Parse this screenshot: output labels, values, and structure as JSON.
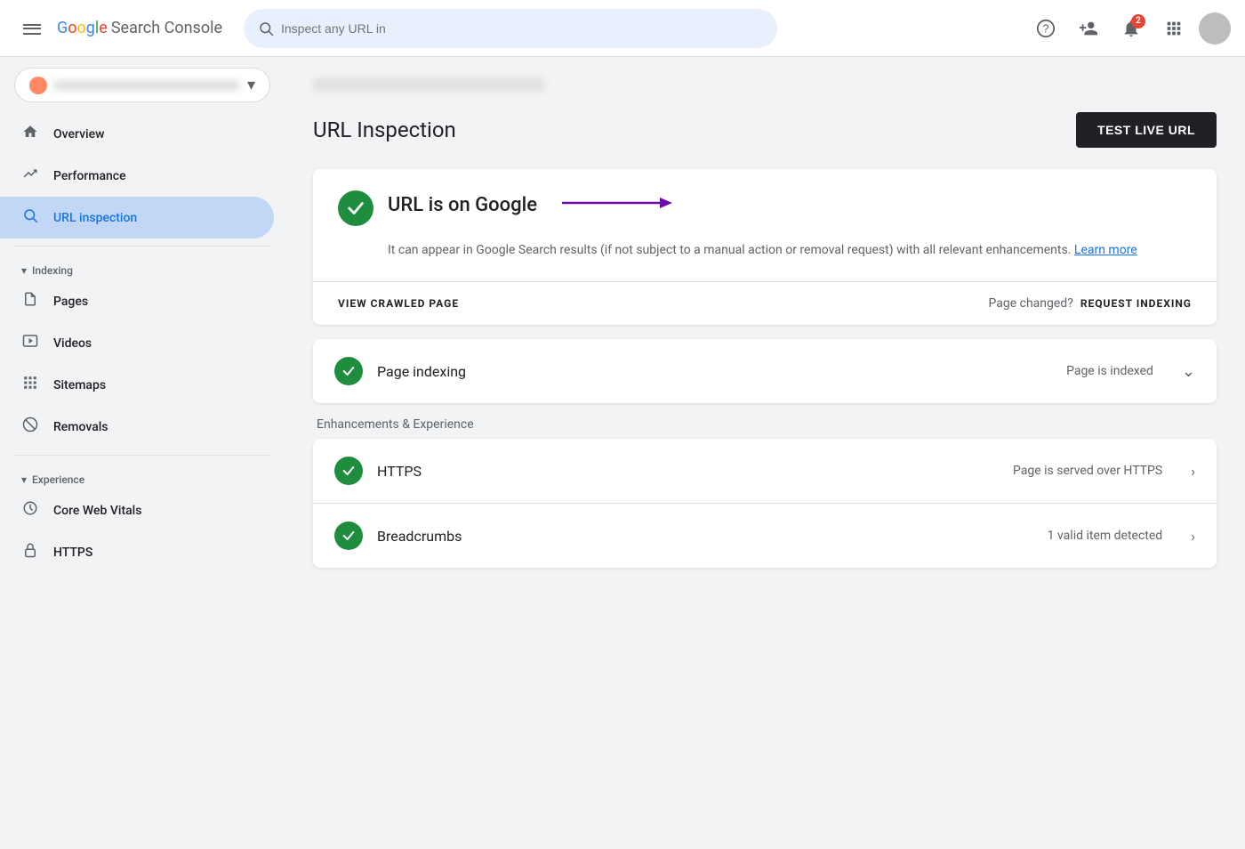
{
  "header": {
    "menu_icon": "☰",
    "logo_text_google": "Google",
    "logo_text_rest": " Search Console",
    "search_placeholder": "Inspect any URL in",
    "notification_count": "2",
    "icons": {
      "help": "?",
      "user_settings": "👤",
      "apps": "⋮⋮⋮",
      "notification": "🔔"
    }
  },
  "sidebar": {
    "property_name": "hidden-property",
    "nav_items": [
      {
        "id": "overview",
        "label": "Overview",
        "icon": "🏠"
      },
      {
        "id": "performance",
        "label": "Performance",
        "icon": "↗"
      },
      {
        "id": "url-inspection",
        "label": "URL inspection",
        "icon": "🔍",
        "active": true
      }
    ],
    "sections": [
      {
        "id": "indexing",
        "label": "Indexing",
        "items": [
          {
            "id": "pages",
            "label": "Pages",
            "icon": "📄"
          },
          {
            "id": "videos",
            "label": "Videos",
            "icon": "📹"
          },
          {
            "id": "sitemaps",
            "label": "Sitemaps",
            "icon": "🗂"
          },
          {
            "id": "removals",
            "label": "Removals",
            "icon": "🚫"
          }
        ]
      },
      {
        "id": "experience",
        "label": "Experience",
        "items": [
          {
            "id": "core-web-vitals",
            "label": "Core Web Vitals",
            "icon": "⏱"
          },
          {
            "id": "https",
            "label": "HTTPS",
            "icon": "🔒"
          }
        ]
      }
    ]
  },
  "main": {
    "breadcrumb": "blurred-url",
    "page_title": "URL Inspection",
    "test_live_url_btn": "TEST LIVE URL",
    "status_card": {
      "title": "URL is on Google",
      "description": "It can appear in Google Search results (if not subject to a manual action or removal request) with all relevant enhancements.",
      "learn_more": "Learn more",
      "view_crawled_page": "VIEW CRAWLED PAGE",
      "page_changed_label": "Page changed?",
      "request_indexing": "REQUEST INDEXING"
    },
    "indexing_row": {
      "label": "Page indexing",
      "status": "Page is indexed"
    },
    "enhancements_section_label": "Enhancements & Experience",
    "enhancements": [
      {
        "id": "https",
        "label": "HTTPS",
        "value": "Page is served over HTTPS"
      },
      {
        "id": "breadcrumbs",
        "label": "Breadcrumbs",
        "value": "1 valid item detected"
      }
    ]
  },
  "colors": {
    "green": "#1e8e3e",
    "blue": "#1a73e8",
    "dark": "#202124",
    "active_nav_bg": "#c2d7f5"
  }
}
